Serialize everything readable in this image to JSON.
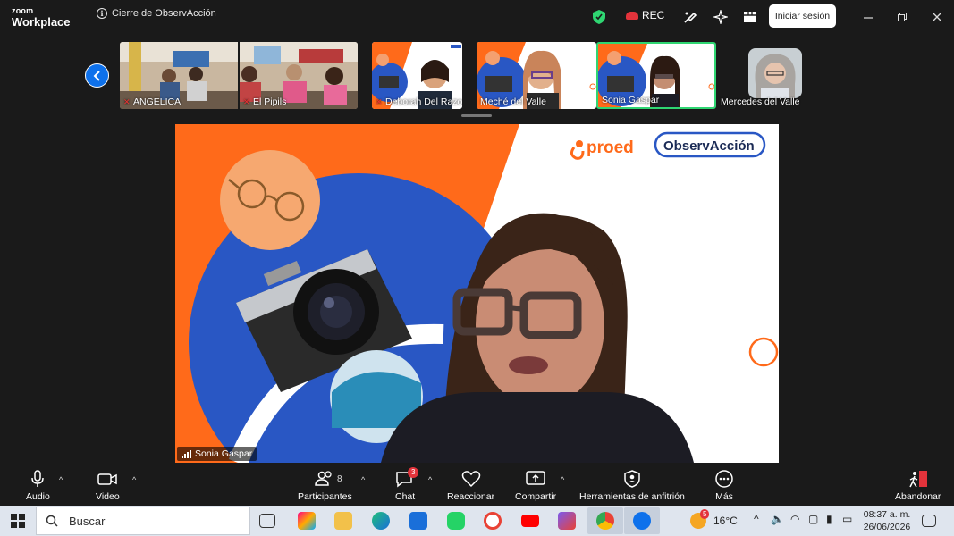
{
  "app": {
    "brand_top": "zoom",
    "brand_bottom": "Workplace",
    "meeting_title": "Cierre de ObservAcción",
    "rec_label": "REC",
    "signin_label": "Iniciar sesión"
  },
  "gallery": {
    "participants": [
      {
        "name": "ANGELICA",
        "muted": true
      },
      {
        "name": "El Pipils",
        "muted": true
      },
      {
        "name": "Deborah Del Razo",
        "muted": true
      },
      {
        "name": "Meché del Valle",
        "muted": false
      },
      {
        "name": "Sonia Gaspar",
        "muted": false,
        "active_speaker": true
      },
      {
        "name": "Mercedes del Valle",
        "muted": false
      }
    ]
  },
  "main_video": {
    "speaker_name": "Sonia Gaspar",
    "logo_left": "proed",
    "logo_right": "ObservAcción"
  },
  "toolbar": {
    "audio": "Audio",
    "video": "Video",
    "participants": "Participantes",
    "participants_count": "8",
    "chat": "Chat",
    "chat_badge": "3",
    "react": "Reaccionar",
    "share": "Compartir",
    "host_tools": "Herramientas de anfitrión",
    "more": "Más",
    "leave": "Abandonar"
  },
  "taskbar": {
    "search_placeholder": "Buscar",
    "weather_badge": "5",
    "temperature": "16°C",
    "time": "08:37 a. m.",
    "date": "26/06/2026",
    "apps": [
      "task-view",
      "copilot",
      "file-explorer",
      "edge",
      "outlook",
      "whatsapp",
      "chrome-maps",
      "youtube",
      "teams-like",
      "chrome",
      "zoom"
    ]
  },
  "colors": {
    "zoom_blue": "#0e71eb",
    "brand_orange": "#ff6a1a",
    "brand_blue": "#2957c4",
    "active_speaker_border": "#2fd672",
    "rec_red": "#e3333b"
  }
}
